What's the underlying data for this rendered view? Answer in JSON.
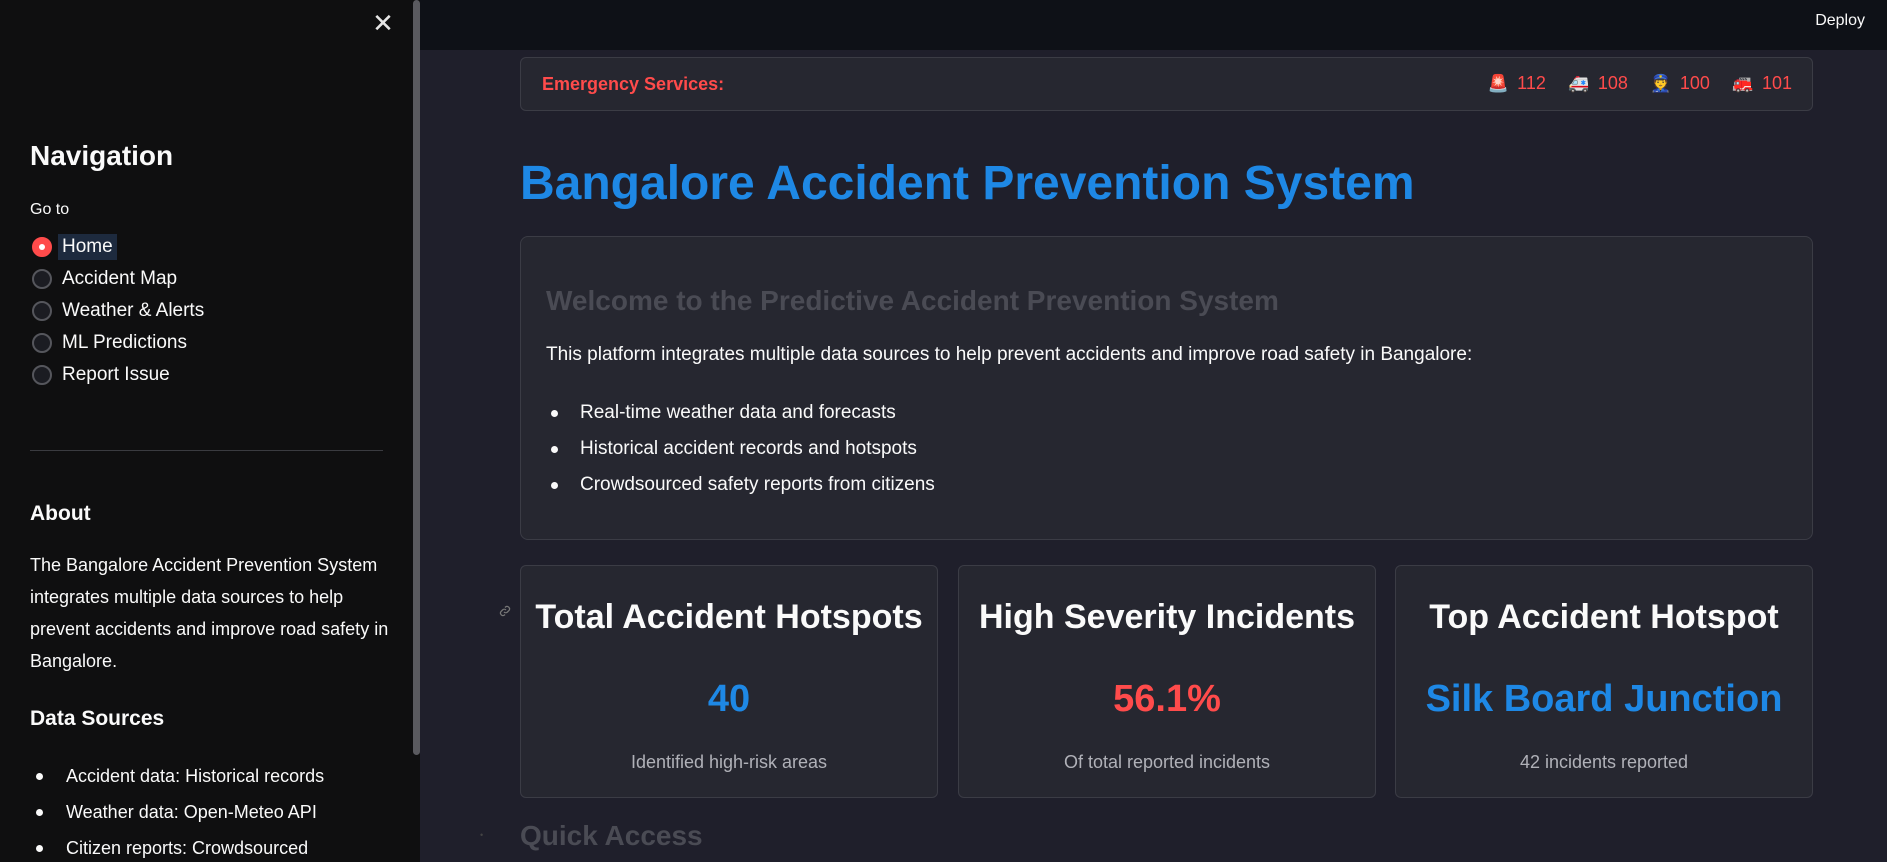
{
  "sidebar": {
    "close_icon": "✕",
    "nav_title": "Navigation",
    "goto_label": "Go to",
    "items": [
      {
        "label": "Home",
        "selected": true
      },
      {
        "label": "Accident Map",
        "selected": false
      },
      {
        "label": "Weather & Alerts",
        "selected": false
      },
      {
        "label": "ML Predictions",
        "selected": false
      },
      {
        "label": "Report Issue",
        "selected": false
      }
    ],
    "about_title": "About",
    "about_text": "The Bangalore Accident Prevention System integrates multiple data sources to help prevent accidents and improve road safety in Bangalore.",
    "sources_title": "Data Sources",
    "sources": [
      "Accident data: Historical records",
      "Weather data: Open-Meteo API",
      "Citizen reports: Crowdsourced"
    ]
  },
  "header": {
    "deploy_label": "Deploy"
  },
  "emergency": {
    "label": "Emergency Services:",
    "numbers": [
      {
        "icon": "🚨",
        "icon_name": "siren-icon",
        "number": "112"
      },
      {
        "icon": "🚑",
        "icon_name": "ambulance-icon",
        "number": "108"
      },
      {
        "icon": "👮",
        "icon_name": "police-icon",
        "number": "100"
      },
      {
        "icon": "🚒",
        "icon_name": "fire-engine-icon",
        "number": "101"
      }
    ]
  },
  "main": {
    "title": "Bangalore Accident Prevention System",
    "welcome": {
      "title": "Welcome to the Predictive Accident Prevention System",
      "description": "This platform integrates multiple data sources to help prevent accidents and improve road safety in Bangalore:",
      "items": [
        "Real-time weather data and forecasts",
        "Historical accident records and hotspots",
        "Crowdsourced safety reports from citizens"
      ]
    },
    "stats": [
      {
        "title": "Total Accident Hotspots",
        "value": "40",
        "sub": "Identified high-risk areas",
        "color": "#1e88e5"
      },
      {
        "title": "High Severity Incidents",
        "value": "56.1%",
        "sub": "Of total reported incidents",
        "color": "#ff4b4b"
      },
      {
        "title": "Top Accident Hotspot",
        "value": "Silk Board Junction",
        "sub": "42 incidents reported",
        "color": "#1e88e5"
      }
    ],
    "quick_access_title": "Quick Access"
  },
  "colors": {
    "accent_blue": "#1e88e5",
    "accent_red": "#ff4b4b",
    "sidebar_bg": "#0f0f10",
    "main_bg": "#1f1f2b"
  }
}
